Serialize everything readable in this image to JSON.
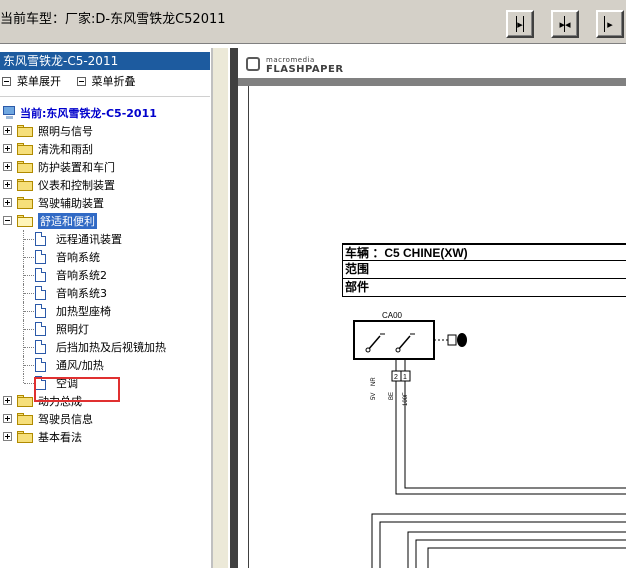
{
  "window": {
    "title": "当前车型：厂家:D-东风雪铁龙C52011"
  },
  "toolbar": {
    "buttons": [
      "fit-page",
      "fit-width",
      "first-page"
    ]
  },
  "tree_panel": {
    "header": "东风雪铁龙-C5-2011",
    "expand_all": "菜单展开",
    "collapse_all": "菜单折叠",
    "current": "当前:东风雪铁龙-C5-2011",
    "groups": [
      {
        "label": "照明与信号"
      },
      {
        "label": "清洗和雨刮"
      },
      {
        "label": "防护装置和车门"
      },
      {
        "label": "仪表和控制装置"
      },
      {
        "label": "驾驶辅助装置"
      },
      {
        "label": "舒适和便利"
      },
      {
        "label": "动力总成"
      },
      {
        "label": "驾驶员信息"
      },
      {
        "label": "基本看法"
      }
    ],
    "children": [
      {
        "label": "远程通讯装置"
      },
      {
        "label": "音响系统"
      },
      {
        "label": "音响系统2"
      },
      {
        "label": "音响系统3"
      },
      {
        "label": "加热型座椅"
      },
      {
        "label": "照明灯"
      },
      {
        "label": "后挡加热及后视镜加热"
      },
      {
        "label": "通风/加热"
      },
      {
        "label": "空调"
      }
    ]
  },
  "viewer": {
    "brand_top": "macromedia",
    "brand_bottom": "FLASHPAPER",
    "spec_rows": [
      "车辆 ：C5 CHINE(XW)",
      "范围",
      "部件"
    ],
    "diagram": {
      "component_label": "CA00",
      "pin_labels": [
        "2",
        "1"
      ],
      "wire_labels": [
        "5V",
        "NR",
        "BE",
        "100F"
      ]
    }
  }
}
